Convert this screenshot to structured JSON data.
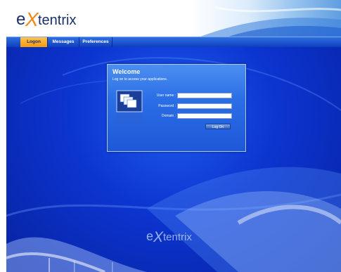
{
  "brand": {
    "name_prefix": "e",
    "name_x": "X",
    "name_suffix": "tentrix"
  },
  "tabs": [
    {
      "label": "Logon",
      "active": true
    },
    {
      "label": "Messages",
      "active": false
    },
    {
      "label": "Preferences",
      "active": false
    }
  ],
  "login": {
    "title": "Welcome",
    "subtitle": "Log on to access your applications.",
    "fields": [
      {
        "label": "User name :",
        "value": ""
      },
      {
        "label": "Password :",
        "value": ""
      },
      {
        "label": "Domain :",
        "value": ""
      }
    ],
    "button_label": "Log On"
  },
  "colors": {
    "accent_tab": "#f39a12",
    "background_blue": "#0c34cf",
    "panel_blue": "#2b6ee6",
    "logo_orange": "#f08a1c",
    "logo_navy": "#1b2f6e"
  }
}
